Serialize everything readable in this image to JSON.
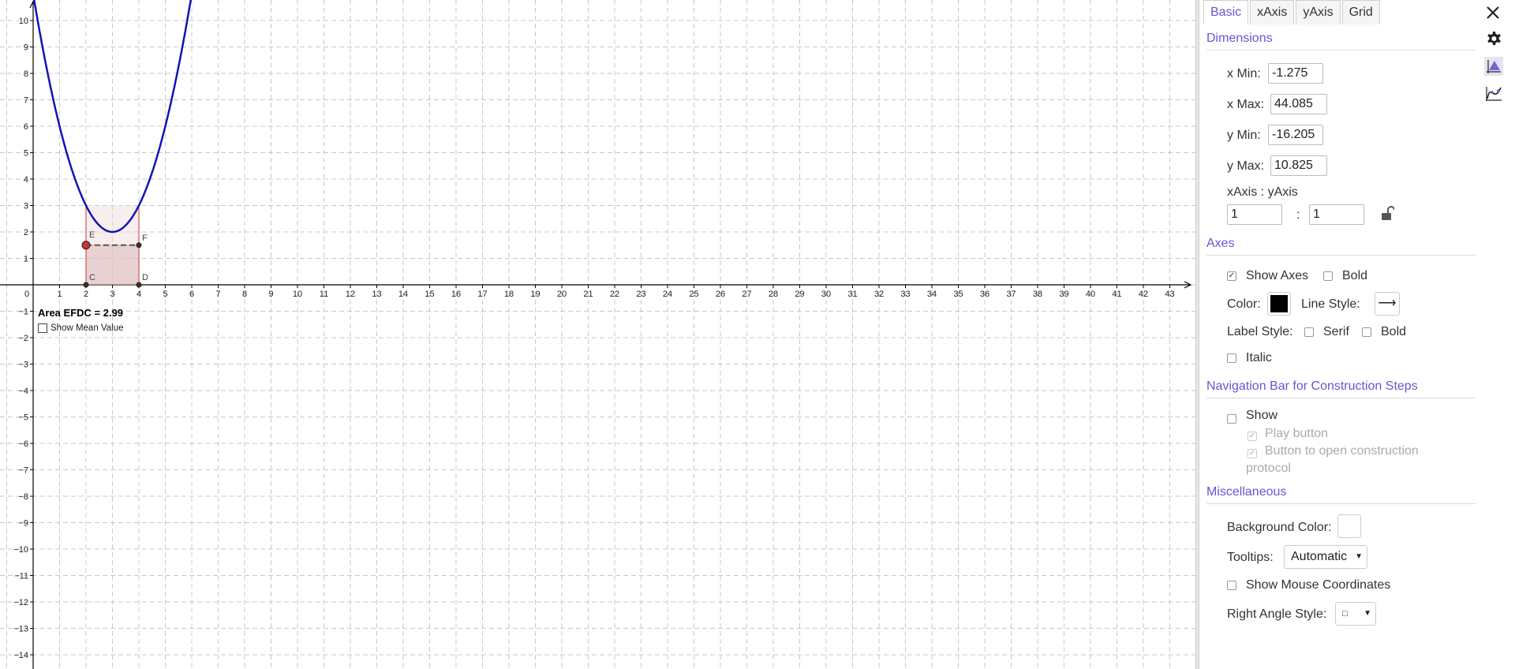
{
  "graphics": {
    "x_ticks": [
      "0",
      "1",
      "2",
      "3",
      "4",
      "5",
      "6",
      "7",
      "8",
      "9",
      "10",
      "11",
      "12",
      "13",
      "14",
      "15",
      "16",
      "17",
      "18",
      "19",
      "20",
      "21",
      "22",
      "23",
      "24",
      "25",
      "26",
      "27",
      "28",
      "29",
      "30",
      "31",
      "32",
      "33",
      "34",
      "35",
      "36",
      "37",
      "38",
      "39",
      "40",
      "41",
      "42",
      "43"
    ],
    "y_ticks": [
      {
        "v": 10,
        "label": "10"
      },
      {
        "v": 9,
        "label": "9"
      },
      {
        "v": 8,
        "label": "8"
      },
      {
        "v": 7,
        "label": "7"
      },
      {
        "v": 6,
        "label": "6"
      },
      {
        "v": 5,
        "label": "5"
      },
      {
        "v": 4,
        "label": "4"
      },
      {
        "v": 3,
        "label": "3"
      },
      {
        "v": 2,
        "label": "2"
      },
      {
        "v": 1,
        "label": "1"
      },
      {
        "v": -1,
        "label": "−1"
      },
      {
        "v": -2,
        "label": "−2"
      },
      {
        "v": -3,
        "label": "−3"
      },
      {
        "v": -4,
        "label": "−4"
      },
      {
        "v": -5,
        "label": "−5"
      },
      {
        "v": -6,
        "label": "−6"
      },
      {
        "v": -7,
        "label": "−7"
      },
      {
        "v": -8,
        "label": "−8"
      },
      {
        "v": -9,
        "label": "−9"
      },
      {
        "v": -10,
        "label": "−10"
      },
      {
        "v": -11,
        "label": "−11"
      },
      {
        "v": -12,
        "label": "−12"
      },
      {
        "v": -13,
        "label": "−13"
      },
      {
        "v": -14,
        "label": "−14"
      }
    ],
    "curve_color": "#1414b4",
    "rect_color": "#cc3333",
    "points": [
      {
        "name": "E",
        "x": 2,
        "y": 1.5
      },
      {
        "name": "F",
        "x": 4,
        "y": 1.5
      },
      {
        "name": "C",
        "x": 2,
        "y": 0
      },
      {
        "name": "D",
        "x": 4,
        "y": 0
      }
    ],
    "area_text": "Area EFDC = 2.99",
    "mean_label": "Show Mean Value"
  },
  "panel": {
    "close_icon": "close-icon",
    "tabs": [
      "Basic",
      "xAxis",
      "yAxis",
      "Grid"
    ],
    "active_tab": "Basic",
    "accent": "#6557d2",
    "dimensions": {
      "title": "Dimensions",
      "xmin_label": "x Min:",
      "xmin": "-1.275",
      "xmax_label": "x Max:",
      "xmax": "44.085",
      "ymin_label": "y Min:",
      "ymin": "-16.205",
      "ymax_label": "y Max:",
      "ymax": "10.825",
      "ratio_label": "xAxis : yAxis",
      "ratio_x": "1",
      "ratio_sep": ":",
      "ratio_y": "1"
    },
    "axes": {
      "title": "Axes",
      "show_axes": "Show Axes",
      "show_axes_checked": true,
      "bold": "Bold",
      "color_label": "Color:",
      "color": "#000000",
      "line_style_label": "Line Style:",
      "line_style_glyph": "⟶",
      "label_style_label": "Label Style:",
      "serif": "Serif",
      "bold2": "Bold",
      "italic": "Italic"
    },
    "navbar": {
      "title": "Navigation Bar for Construction Steps",
      "show": "Show",
      "play": "Play button",
      "protocol": "Button to open construction",
      "protocol2": "protocol"
    },
    "misc": {
      "title": "Miscellaneous",
      "bg_label": "Background Color:",
      "bg_color": "#ffffff",
      "tooltips_label": "Tooltips:",
      "tooltips_value": "Automatic",
      "mouse_coords": "Show Mouse Coordinates",
      "right_angle_label": "Right Angle Style:",
      "right_angle_value": "□"
    }
  },
  "sidebar": {
    "icons": [
      "gear-icon",
      "graphics-view-icon",
      "curve-icon"
    ]
  }
}
